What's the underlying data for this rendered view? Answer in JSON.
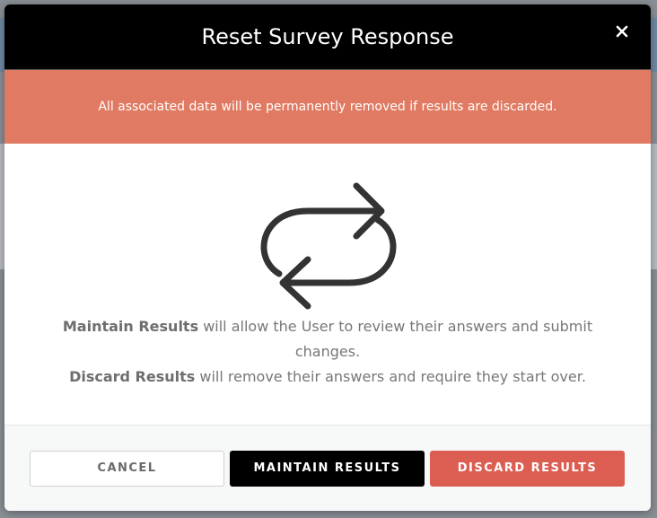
{
  "modal": {
    "title": "Reset Survey Response",
    "close_label": "×",
    "warning": "All associated data will be permanently removed if results are discarded.",
    "icon": "refresh-icon",
    "description": {
      "maintain_bold": "Maintain Results",
      "maintain_text": " will allow the User to review their answers and submit changes.",
      "discard_bold": "Discard Results",
      "discard_text": " will remove their answers and require they start over."
    }
  },
  "footer": {
    "cancel_label": "CANCEL",
    "maintain_label": "MAINTAIN RESULTS",
    "discard_label": "DISCARD RESULTS"
  },
  "colors": {
    "header_bg": "#000000",
    "warning_bg": "#e07a62",
    "discard_bg": "#dc5d52",
    "maintain_bg": "#000000"
  }
}
